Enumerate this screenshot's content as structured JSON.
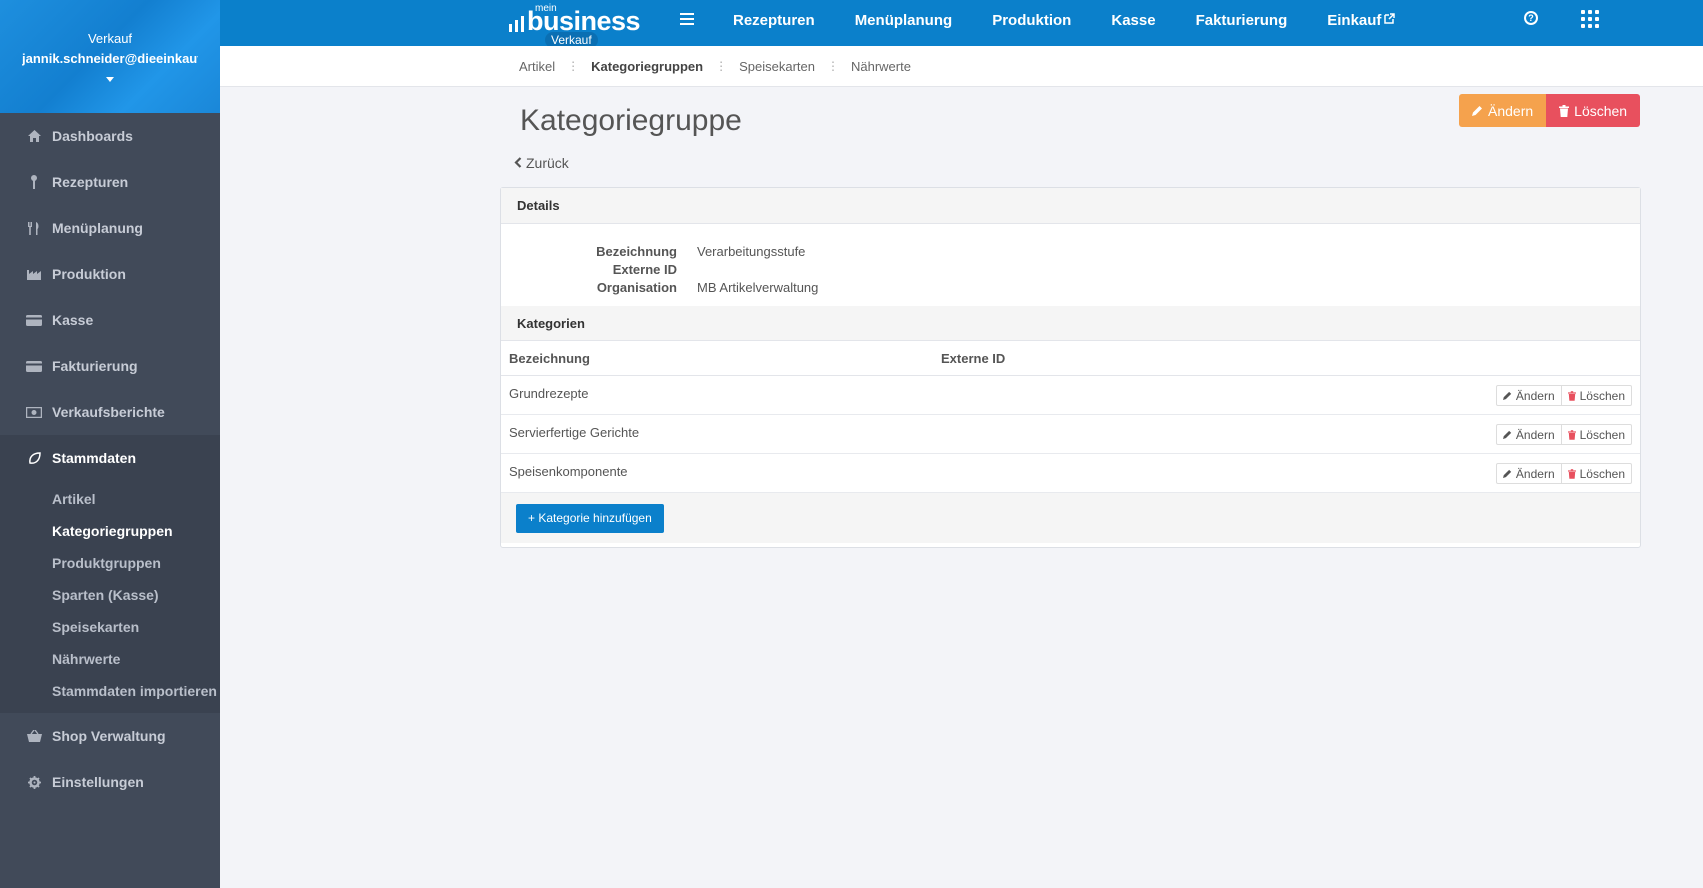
{
  "user": {
    "role": "Verkauf",
    "email": "jannik.schneider@dieeinkauf"
  },
  "brand": {
    "prefix": "mein",
    "name": "business",
    "tag": "Verkauf",
    "color": "#0b80cb"
  },
  "sidebar": {
    "items": [
      {
        "label": "Dashboards",
        "icon": "home-icon"
      },
      {
        "label": "Rezepturen",
        "icon": "spoon-icon"
      },
      {
        "label": "Menüplanung",
        "icon": "cutlery-icon"
      },
      {
        "label": "Produktion",
        "icon": "factory-icon"
      },
      {
        "label": "Kasse",
        "icon": "card-icon"
      },
      {
        "label": "Fakturierung",
        "icon": "card-icon"
      },
      {
        "label": "Verkaufsberichte",
        "icon": "money-icon"
      },
      {
        "label": "Stammdaten",
        "icon": "leaf-icon"
      },
      {
        "label": "Shop Verwaltung",
        "icon": "basket-icon"
      },
      {
        "label": "Einstellungen",
        "icon": "gear-icon"
      }
    ],
    "sub_items": [
      {
        "label": "Artikel"
      },
      {
        "label": "Kategoriegruppen"
      },
      {
        "label": "Produktgruppen"
      },
      {
        "label": "Sparten (Kasse)"
      },
      {
        "label": "Speisekarten"
      },
      {
        "label": "Nährwerte"
      },
      {
        "label": "Stammdaten importieren"
      }
    ]
  },
  "topnav": {
    "items": [
      {
        "label": "Rezepturen"
      },
      {
        "label": "Menüplanung"
      },
      {
        "label": "Produktion"
      },
      {
        "label": "Kasse"
      },
      {
        "label": "Fakturierung"
      },
      {
        "label": "Einkauf"
      }
    ],
    "help_label": "?"
  },
  "subnav": {
    "items": [
      {
        "label": "Artikel"
      },
      {
        "label": "Kategoriegruppen"
      },
      {
        "label": "Speisekarten"
      },
      {
        "label": "Nährwerte"
      }
    ],
    "separator": "⋮"
  },
  "page": {
    "title": "Kategoriegruppe",
    "back_label": "Zurück",
    "edit_label": "Ändern",
    "delete_label": "Löschen"
  },
  "details": {
    "header": "Details",
    "rows": [
      {
        "label": "Bezeichnung",
        "value": "Verarbeitungsstufe"
      },
      {
        "label": "Externe ID",
        "value": ""
      },
      {
        "label": "Organisation",
        "value": "MB Artikelverwaltung"
      }
    ]
  },
  "categories": {
    "header": "Kategorien",
    "columns": [
      "Bezeichnung",
      "Externe ID"
    ],
    "rows": [
      {
        "name": "Grundrezepte",
        "external_id": ""
      },
      {
        "name": "Servierfertige Gerichte",
        "external_id": ""
      },
      {
        "name": "Speisenkomponente",
        "external_id": ""
      }
    ],
    "edit_label": "Ändern",
    "delete_label": "Löschen",
    "add_label": "+ Kategorie hinzufügen"
  },
  "colors": {
    "sidebar_bg": "#414a59",
    "edit_button": "#f5a24d",
    "delete_button": "#e8505e"
  }
}
